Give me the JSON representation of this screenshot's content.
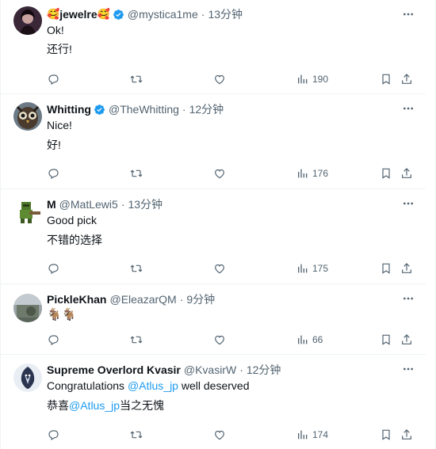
{
  "colors": {
    "accent": "#1d9bf0",
    "muted": "#536471",
    "text": "#0f1419",
    "divider": "#eff3f4"
  },
  "tweets": [
    {
      "name_prefix_emoji": "🥰",
      "name": "jewelre",
      "name_suffix_emoji": "🥰",
      "verified": true,
      "handle": "@mystica1me",
      "time": "13分钟",
      "line1": "Ok!",
      "line2": "还行!",
      "views": "190"
    },
    {
      "name": "Whitting",
      "verified": true,
      "handle": "@TheWhitting",
      "time": "12分钟",
      "line1": "Nice!",
      "line2": "好!",
      "views": "176"
    },
    {
      "name": "M",
      "verified": false,
      "handle": "@MatLewi5",
      "time": "13分钟",
      "line1": "Good pick",
      "line2": "不错的选择",
      "views": "175"
    },
    {
      "name": "PickleKhan",
      "verified": false,
      "handle": "@EleazarQM",
      "time": "9分钟",
      "line1": "🐐🐐",
      "views": "66"
    },
    {
      "name": "Supreme Overlord Kvasir",
      "verified": false,
      "handle": "@KvasirW",
      "time": "12分钟",
      "line1_pre": "Congratulations ",
      "line1_mention": "@Atlus_jp",
      "line1_post": " well deserved",
      "line2_pre": "恭喜",
      "line2_mention": "@Atlus_jp",
      "line2_post": "当之无愧",
      "views": "174"
    }
  ],
  "icons": {
    "reply": "reply-icon",
    "retweet": "retweet-icon",
    "like": "like-icon",
    "views": "views-icon",
    "bookmark": "bookmark-icon",
    "share": "share-icon",
    "more": "more-icon",
    "verified": "verified-icon"
  }
}
